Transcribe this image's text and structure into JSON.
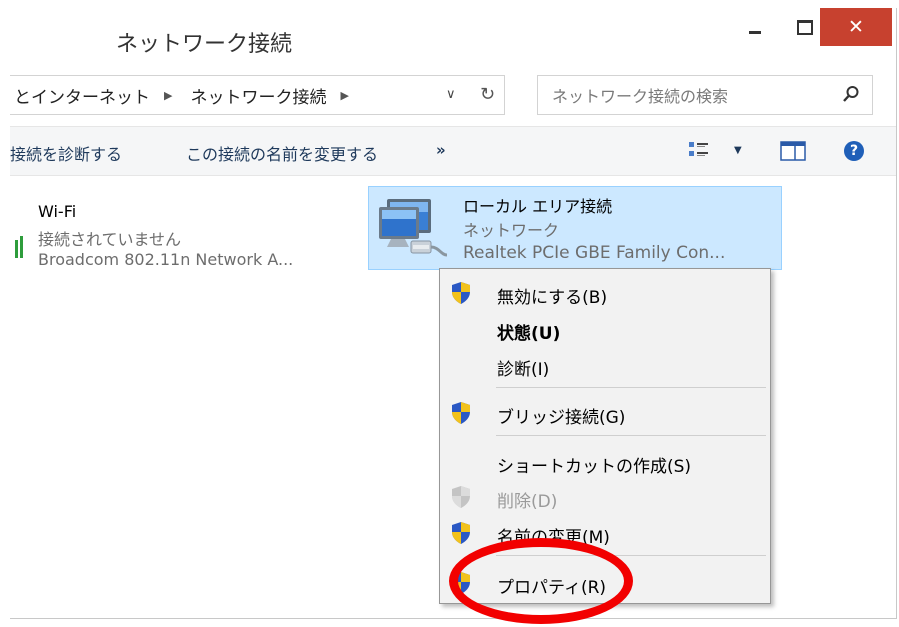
{
  "window": {
    "title": "ネットワーク接続",
    "close_glyph": "✕"
  },
  "address": {
    "crumb_1": "とインターネット",
    "crumb_2": "ネットワーク接続",
    "search_placeholder": "ネットワーク接続の検索"
  },
  "commands": {
    "diagnose": "接続を診断する",
    "rename": "この接続の名前を変更する",
    "more": "»"
  },
  "connections": [
    {
      "name": "Wi-Fi",
      "status": "接続されていません",
      "device": "Broadcom 802.11n Network A..."
    },
    {
      "name": "ローカル エリア接続",
      "status": "ネットワーク",
      "device": "Realtek PCIe GBE Family Con..."
    }
  ],
  "context_menu": {
    "disable": "無効にする(B)",
    "status": "状態(U)",
    "diagnose": "診断(I)",
    "bridge": "ブリッジ接続(G)",
    "shortcut": "ショートカットの作成(S)",
    "delete": "削除(D)",
    "rename": "名前の変更(M)",
    "properties": "プロパティ(R)"
  },
  "colors": {
    "selection_bg": "#cce8ff",
    "close_button": "#c7412f",
    "highlight_ring": "#f20000",
    "wifi_signal": "#2e9d3c"
  },
  "icons": {
    "search": "search-icon",
    "refresh": "refresh-icon",
    "help": "help-icon",
    "shield": "uac-shield-icon"
  }
}
